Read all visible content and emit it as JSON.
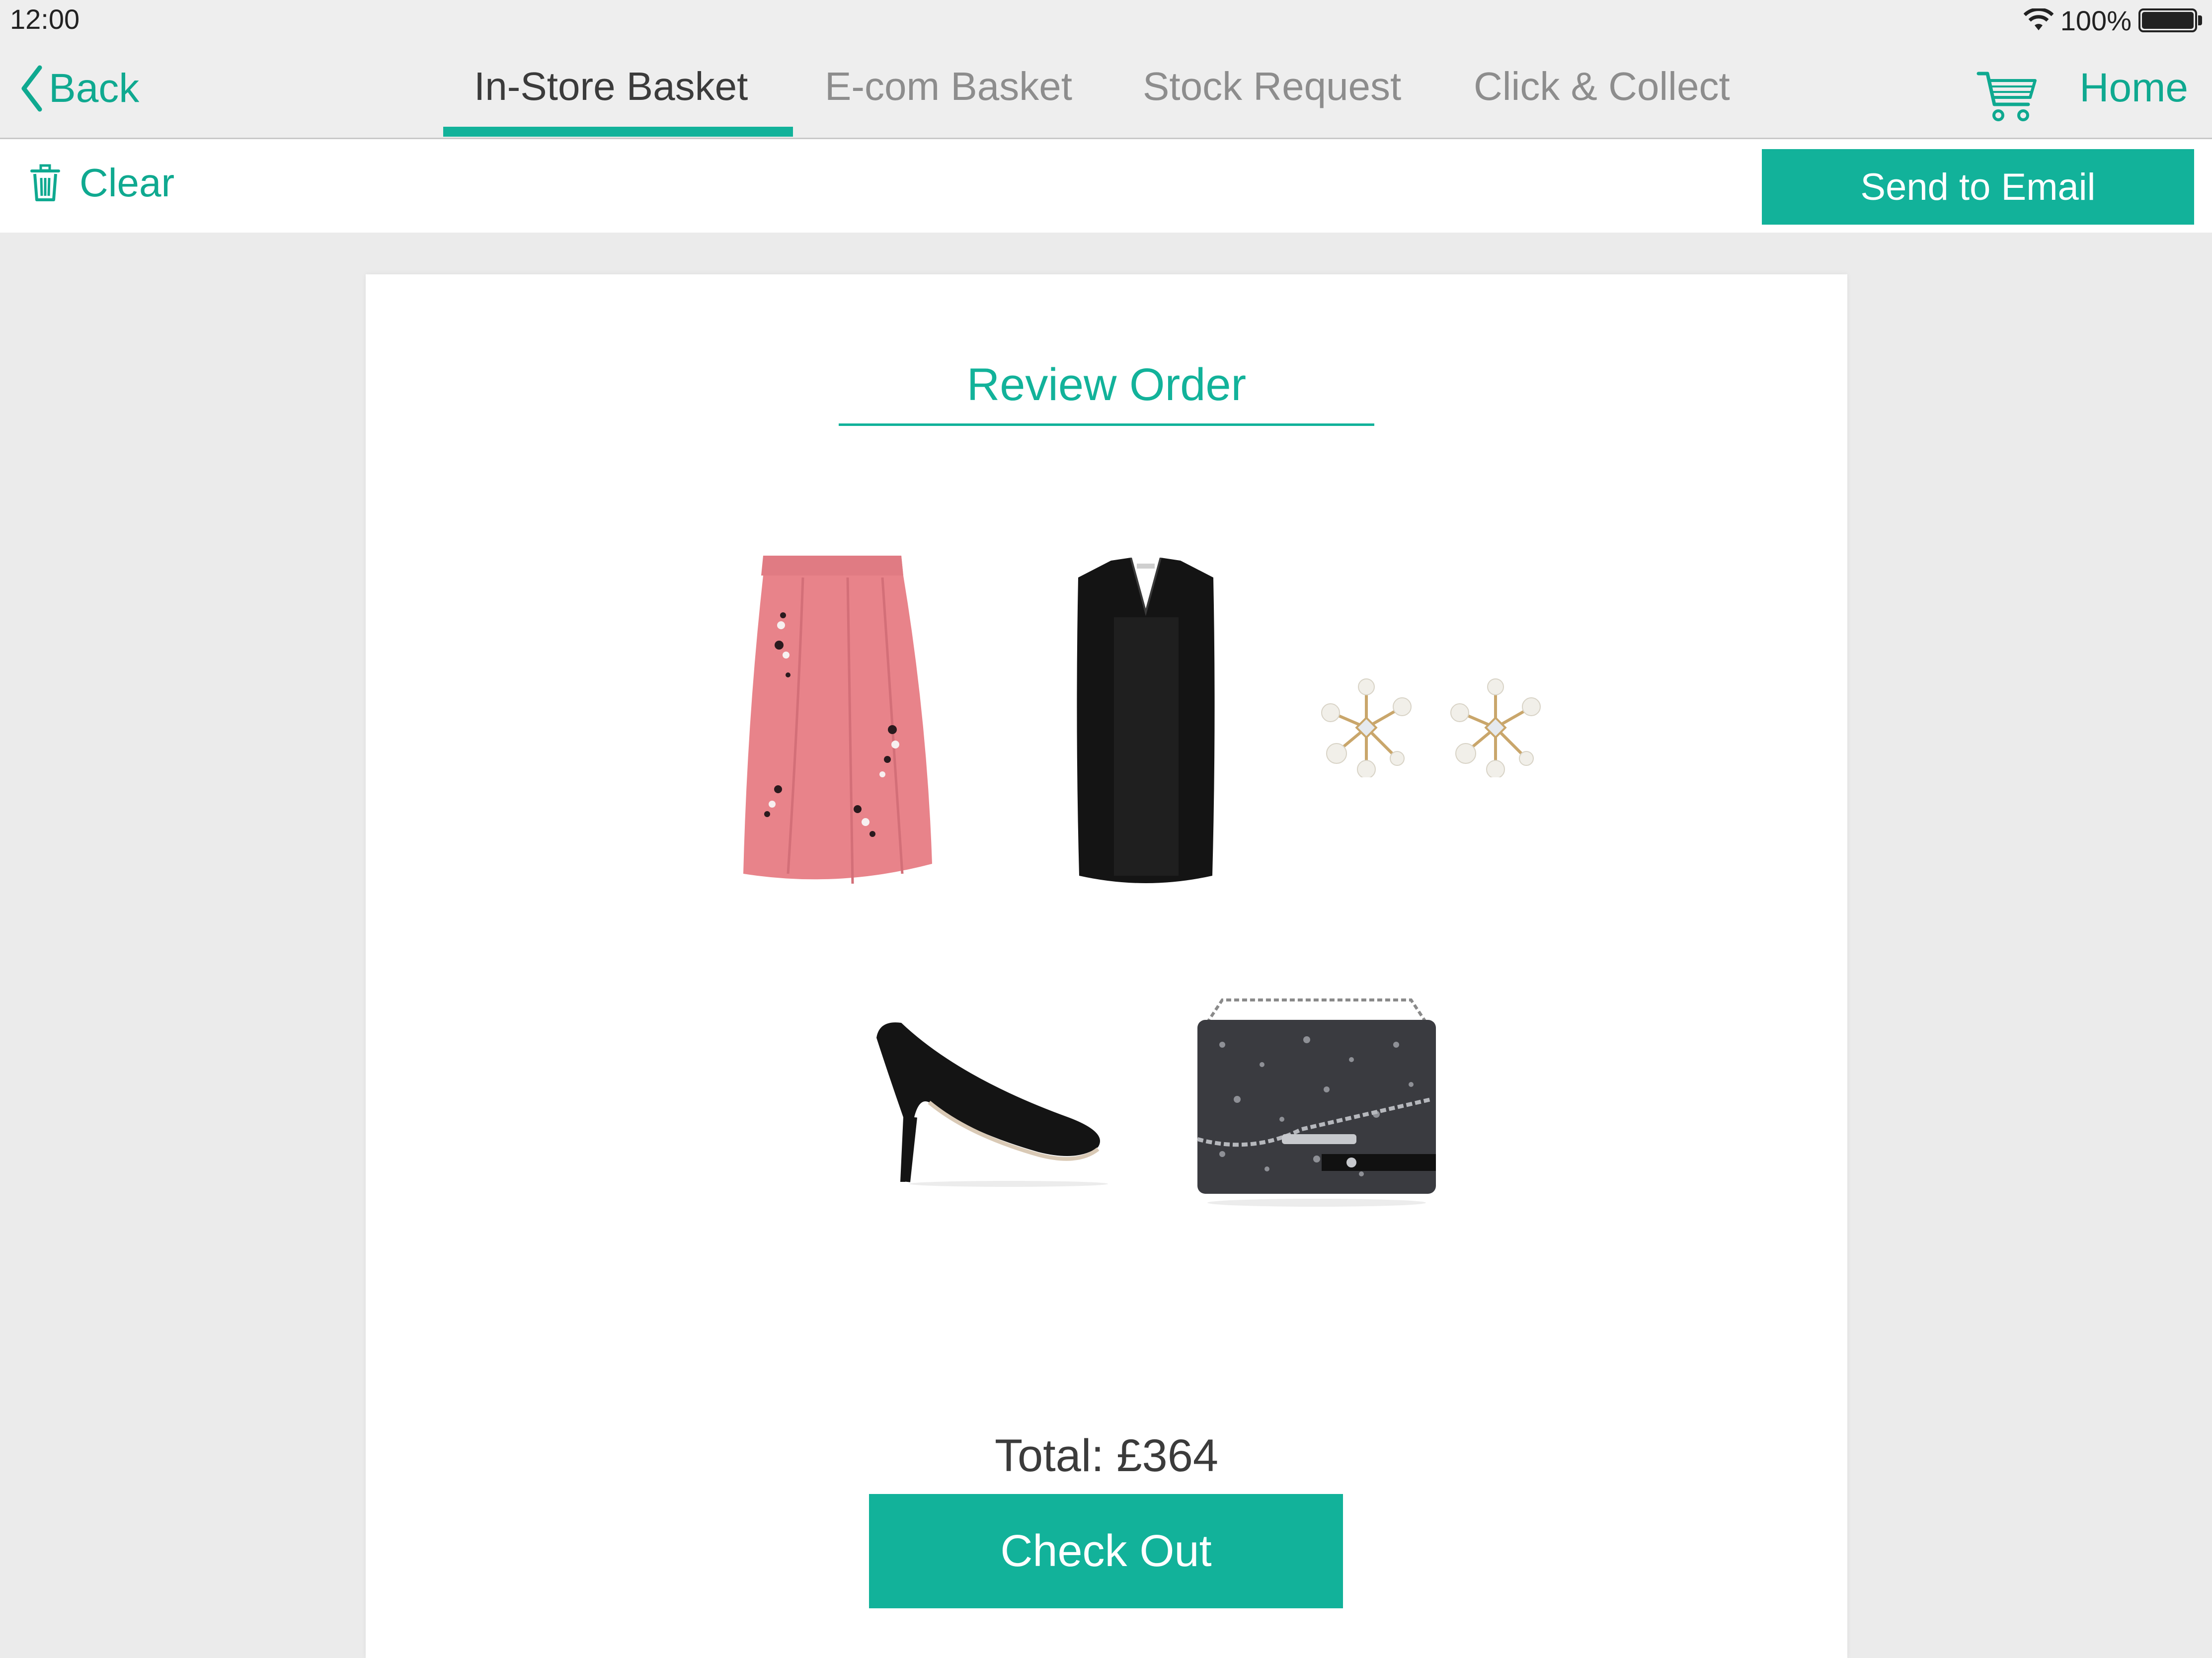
{
  "status_bar": {
    "time": "12:00",
    "battery": "100%"
  },
  "nav": {
    "back_label": "Back",
    "tabs": [
      {
        "label": "In-Store Basket",
        "active": true
      },
      {
        "label": "E-com Basket",
        "active": false
      },
      {
        "label": "Stock Request",
        "active": false
      },
      {
        "label": "Click & Collect",
        "active": false
      }
    ],
    "cart_icon": "cart-icon",
    "home_label": "Home"
  },
  "toolbar": {
    "clear_label": "Clear",
    "clear_icon": "trash-icon",
    "send_label": "Send to Email"
  },
  "review": {
    "title": "Review Order",
    "products": [
      {
        "icon": "skirt-product-image"
      },
      {
        "icon": "top-product-image"
      },
      {
        "icon": "earrings-product-image"
      },
      {
        "icon": "heels-product-image"
      },
      {
        "icon": "clutch-bag-product-image"
      }
    ],
    "total": "Total: £364",
    "checkout_label": "Check Out"
  },
  "colors": {
    "accent": "#12b29a",
    "background": "#ebebeb",
    "inactive_tab": "#8d8d8d",
    "active_tab": "#3b3b3b"
  }
}
